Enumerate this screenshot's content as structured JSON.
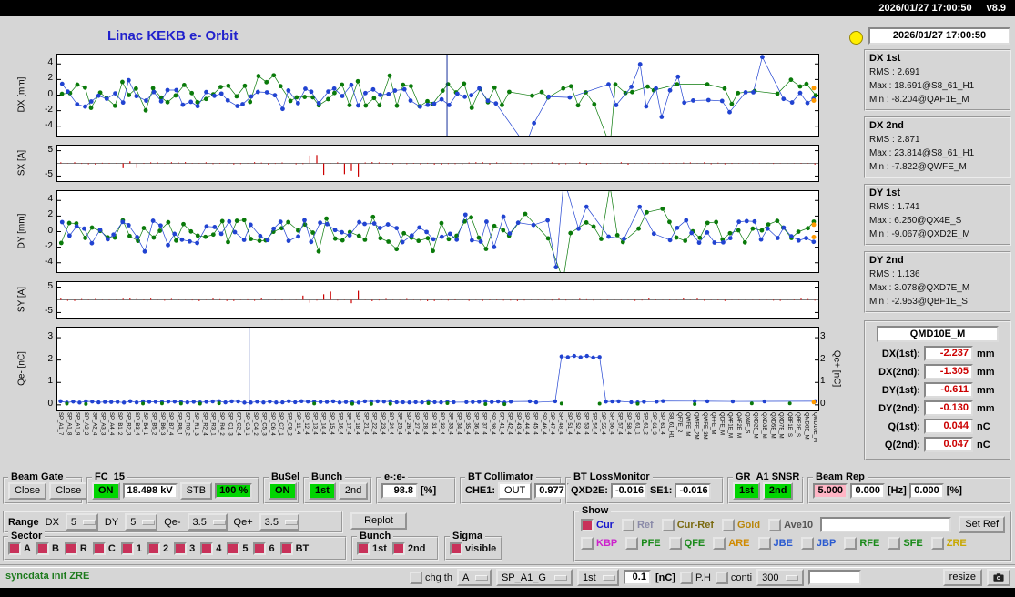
{
  "titlebar": {
    "datetime": "2026/01/27 17:00:50",
    "version": "v8.9"
  },
  "title": "Linac KEKB e- Orbit",
  "right_panel": {
    "timestamp": "2026/01/27 17:00:50",
    "stat_groups": [
      {
        "label": "DX 1st",
        "rows": [
          "RMS : 2.691",
          "Max : 18.691@S8_61_H1",
          "Min : -8.204@QAF1E_M"
        ]
      },
      {
        "label": "DX 2nd",
        "rows": [
          "RMS : 2.871",
          "Max : 23.814@S8_61_H1",
          "Min : -7.822@QWFE_M"
        ]
      },
      {
        "label": "DY 1st",
        "rows": [
          "RMS : 1.741",
          "Max : 6.250@QX4E_S",
          "Min : -9.067@QXD2E_M"
        ]
      },
      {
        "label": "DY 2nd",
        "rows": [
          "RMS : 1.136",
          "Max : 3.078@QXD7E_M",
          "Min : -2.953@QBF1E_S"
        ]
      }
    ],
    "monitor": {
      "title": "QMD10E_M",
      "rows": [
        {
          "label": "DX(1st):",
          "value": "-2.237",
          "unit": "mm"
        },
        {
          "label": "DX(2nd):",
          "value": "-1.305",
          "unit": "mm"
        },
        {
          "label": "DY(1st):",
          "value": "-0.611",
          "unit": "mm"
        },
        {
          "label": "DY(2nd):",
          "value": "-0.130",
          "unit": "mm"
        },
        {
          "label": "Q(1st):",
          "value": "0.044",
          "unit": "nC"
        },
        {
          "label": "Q(2nd):",
          "value": "0.047",
          "unit": "nC"
        }
      ]
    }
  },
  "plots": [
    {
      "id": "dx",
      "type": "orbit",
      "ylabel": "DX [mm]",
      "ymin": -5.2,
      "ymax": 5.2,
      "yticks": [
        4,
        2,
        0,
        -2,
        -4
      ],
      "series": [
        {
          "name": "2nd",
          "color": "#0a7a0a",
          "seed": 23
        },
        {
          "name": "1st",
          "color": "#2143d1",
          "seed": 77
        }
      ],
      "vline": 0.512,
      "wild": [
        0.58,
        0.97
      ]
    },
    {
      "id": "sx",
      "type": "steer",
      "ylabel": "SX [A]",
      "ymin": -7,
      "ymax": 7,
      "yticks": [
        5,
        -5
      ],
      "color": "#cc0000",
      "seed": 5,
      "bursts": [
        [
          0.085,
          0.125,
          2.0
        ],
        [
          0.33,
          0.42,
          5.2
        ]
      ]
    },
    {
      "id": "dy",
      "type": "orbit",
      "ylabel": "DY [mm]",
      "ymin": -5.2,
      "ymax": 5.2,
      "yticks": [
        4,
        2,
        0,
        -2,
        -4
      ],
      "series": [
        {
          "name": "2nd",
          "color": "#0a7a0a",
          "seed": 41
        },
        {
          "name": "1st",
          "color": "#2143d1",
          "seed": 13
        }
      ],
      "vline": null,
      "wild": [
        0.6,
        0.8
      ]
    },
    {
      "id": "sy",
      "type": "steer",
      "ylabel": "SY [A]",
      "ymin": -7,
      "ymax": 7,
      "yticks": [
        5,
        -5
      ],
      "color": "#cc0000",
      "seed": 9,
      "bursts": [
        [
          0.31,
          0.4,
          4.2
        ]
      ]
    },
    {
      "id": "q",
      "type": "charge",
      "ylabel": "Qe- [nC]",
      "ylabel_right": "Qe+ [nC]",
      "ymin": -0.25,
      "ymax": 3.45,
      "yticks": [
        3,
        2,
        1,
        0
      ],
      "series_blue": {
        "color": "#2143d1",
        "seed": 3
      },
      "series_green": {
        "color": "#0a7a0a",
        "seed": 8
      },
      "vline": 0.252,
      "plateau": [
        0.655,
        0.715,
        2.15
      ]
    }
  ],
  "x_labels": [
    "SP_A1_7",
    "SP_A1_8",
    "SP_A1_9",
    "SP_A2_2",
    "SP_A2_4",
    "SP_A3_3",
    "SP_A4_4",
    "SP_B1_2",
    "SP_B2_3",
    "SP_B3_4",
    "SP_B4_1",
    "SP_B5_2",
    "SP_B6_3",
    "SP_B7_4",
    "SP_B8_1",
    "SP_R0_2",
    "SP_R1_3",
    "SP_R2_4",
    "SP_R3_1",
    "SP_R4_2",
    "SP_C1_3",
    "SP_C2_4",
    "SP_C3_1",
    "SP_C4_2",
    "SP_C5_3",
    "SP_C6_4",
    "SP_C7_1",
    "SP_C8_2",
    "SP_11_4",
    "SP_12_4",
    "SP_13_4",
    "SP_14_4",
    "SP_15_4",
    "SP_16_4",
    "SP_17_4",
    "SP_18_4",
    "SP_21_4",
    "SP_22_4",
    "SP_23_4",
    "SP_24_4",
    "SP_25_4",
    "SP_26_4",
    "SP_27_4",
    "SP_28_4",
    "SP_31_4",
    "SP_32_4",
    "SP_33_4",
    "SP_34_4",
    "SP_35_4",
    "SP_36_4",
    "SP_37_4",
    "SP_38_4",
    "SP_41_4",
    "SP_42_4",
    "SP_43_4",
    "SP_44_4",
    "SP_45_4",
    "SP_46_4",
    "SP_47_4",
    "SP_48_4",
    "SP_51_4",
    "SP_52_4",
    "SP_53_4",
    "SP_54_4",
    "SP_55_4",
    "SP_56_4",
    "SP_57_4",
    "SP_58_4",
    "SP_61_1",
    "SP_61_2",
    "SP_61_3",
    "SP_61_4",
    "S8_61_H1",
    "QF7E_2",
    "QWFE_M",
    "QWFE_2M",
    "QWFE_3M",
    "QFFE_M",
    "QDFE_M",
    "QAF1E_M",
    "QAF2E_M",
    "QX4E_S",
    "QXD2E_M",
    "QXD3E_M",
    "QXD5E_M",
    "QXD7E_M",
    "QBF1E_S",
    "QBF2E_S",
    "QMD8E_M",
    "QMD10E_M"
  ],
  "panels": {
    "beam_gate": {
      "label": "Beam Gate",
      "btn1": "Close",
      "btn2": "Close"
    },
    "fc15": {
      "label": "FC_15",
      "on": "ON",
      "kv": "18.498 kV",
      "stb": "STB",
      "pct": "100 %"
    },
    "busel": {
      "label": "BuSel",
      "on": "ON"
    },
    "bunch": {
      "label": "Bunch",
      "b1": "1st",
      "b2": "2nd"
    },
    "ee": {
      "label": "e-:e-",
      "value": "98.8",
      "unit": "[%]"
    },
    "bt_col": {
      "label": "BT Collimator",
      "che1": "CHE1:",
      "out": "OUT",
      "value": "0.977"
    },
    "bt_loss": {
      "label": "BT LossMonitor",
      "l1": "QXD2E:",
      "v1": "-0.016",
      "l2": "SE1:",
      "v2": "-0.016"
    },
    "gr_a1": {
      "label": "GR_A1 SNSR",
      "b1": "1st",
      "b2": "2nd"
    },
    "beam_rep": {
      "label": "Beam Rep",
      "v1": "5.000",
      "v2": "0.000",
      "u1": "[Hz]",
      "v3": "0.000",
      "u2": "[%]"
    },
    "range": {
      "label": "Range",
      "dx_label": "DX",
      "dx": "5",
      "dy_label": "DY",
      "dy": "5",
      "qem_label": "Qe-",
      "qem": "3.5",
      "qep_label": "Qe+",
      "qep": "3.5"
    },
    "replot": "Replot",
    "show": {
      "label": "Show",
      "row1": [
        {
          "text": "Cur",
          "color": "#1515cc",
          "checked": true
        },
        {
          "text": "Ref",
          "color": "#8a8aa8",
          "checked": false
        },
        {
          "text": "Cur-Ref",
          "color": "#7a6a10",
          "checked": false
        },
        {
          "text": "Gold",
          "color": "#b8860b",
          "checked": false
        },
        {
          "text": "Ave10",
          "color": "#555555",
          "checked": false
        }
      ],
      "ref_input": "",
      "set_ref": "Set Ref",
      "row2": [
        {
          "text": "KBP",
          "color": "#cc22cc",
          "checked": false
        },
        {
          "text": "PFE",
          "color": "#1a8a1a",
          "checked": false
        },
        {
          "text": "QFE",
          "color": "#1a8a1a",
          "checked": false
        },
        {
          "text": "ARE",
          "color": "#d08a00",
          "checked": false
        },
        {
          "text": "JBE",
          "color": "#2a5ad0",
          "checked": false
        },
        {
          "text": "JBP",
          "color": "#2a5ad0",
          "checked": false
        },
        {
          "text": "RFE",
          "color": "#1a8a1a",
          "checked": false
        },
        {
          "text": "SFE",
          "color": "#1a8a1a",
          "checked": false
        },
        {
          "text": "ZRE",
          "color": "#c8a800",
          "checked": false
        }
      ]
    },
    "sector": {
      "label": "Sector",
      "items": [
        "A",
        "B",
        "R",
        "C",
        "1",
        "2",
        "3",
        "4",
        "5",
        "6",
        "BT"
      ]
    },
    "bunch_sel": {
      "label": "Bunch",
      "items": [
        "1st",
        "2nd"
      ]
    },
    "sigma": {
      "label": "Sigma",
      "items": [
        "visible"
      ]
    },
    "statusbar": {
      "message": "syncdata init ZRE",
      "chg_th": "chg th",
      "dd_a": "A",
      "dd_sp": "SP_A1_G",
      "dd_bunch": "1st",
      "threshold": "0.1",
      "unit": "[nC]",
      "ph": "P.H",
      "conti": "conti",
      "dd_rate": "300",
      "resize": "resize"
    }
  },
  "colors": {
    "status_light": "#ffee00",
    "on_green": "#00d500",
    "alarm_pink": "#ffb5c5",
    "value_red": "#cc0000",
    "title_blue": "#2121cc",
    "bunch1_blue": "#2143d1",
    "bunch2_green": "#0a7a0a",
    "steer_red": "#cc0000",
    "marker_orange": "#ff9900"
  }
}
